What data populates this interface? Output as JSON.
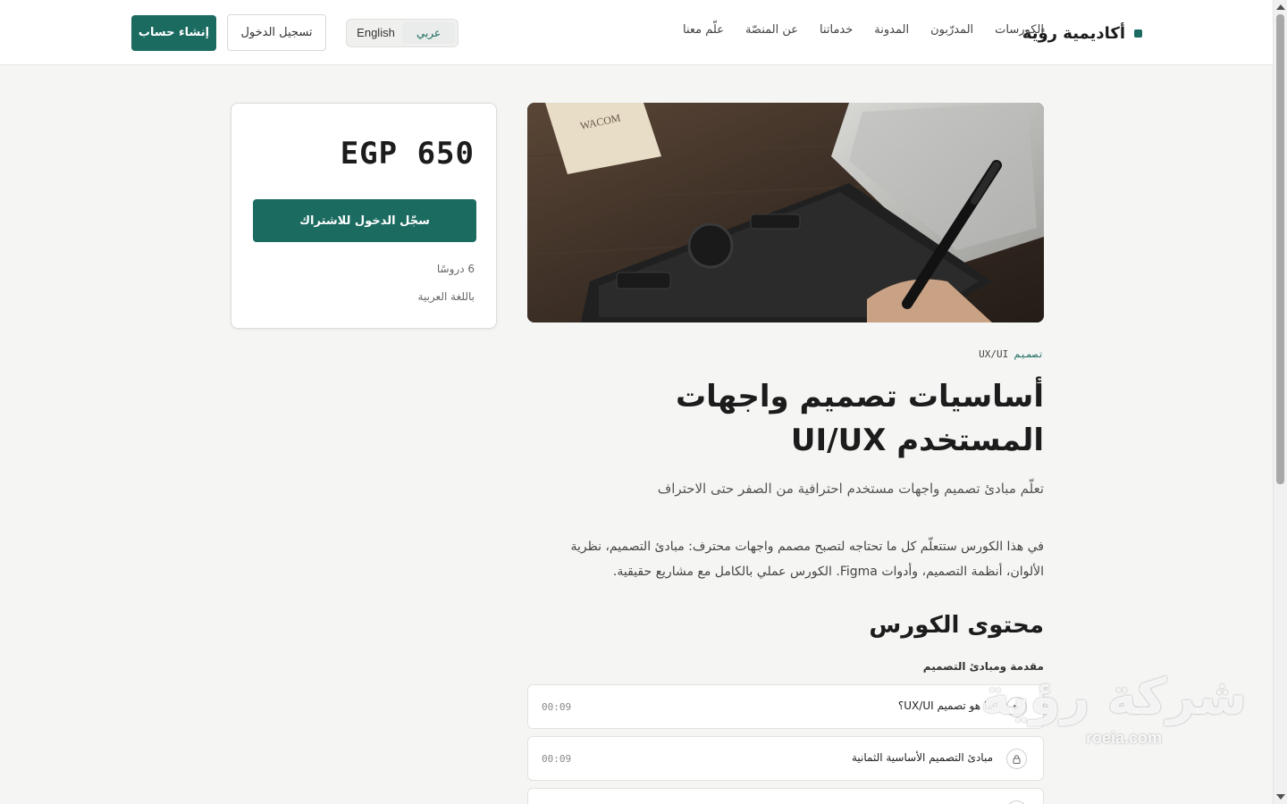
{
  "header": {
    "brand": "أكاديمية رؤية",
    "nav": [
      "الكورسات",
      "المدرّبون",
      "المدونة",
      "خدماتنا",
      "عن المنصّة",
      "علّم معنا"
    ],
    "lang_ar": "عربي",
    "lang_en": "English",
    "login_label": "تسجيل الدخول",
    "signup_label": "إنشاء حساب"
  },
  "price_card": {
    "price": "EGP 650",
    "subscribe_label": "سجّل الدخول للاشتراك",
    "lessons_count": "6 دروسًا",
    "language": "باللغة العربية"
  },
  "course": {
    "tag_prefix": "تصميم",
    "tag_suffix": "UX/UI",
    "title": "أساسيات تصميم واجهات المستخدم UI/UX",
    "subtitle": "تعلّم مبادئ تصميم واجهات مستخدم احترافية من الصفر حتى الاحتراف",
    "description": "في هذا الكورس ستتعلّم كل ما تحتاجه لتصبح مصمم واجهات محترف: مبادئ التصميم، نظرية الألوان، أنظمة التصميم، وأدوات Figma. الكورس عملي بالكامل مع مشاريع حقيقية."
  },
  "content": {
    "section_title": "محتوى الكورس",
    "module_title": "مقدمة ومبادئ التصميم",
    "lessons": [
      {
        "title": "ما هو تصميم UX/UI؟",
        "time": "00:09",
        "icon": "play-icon"
      },
      {
        "title": "مبادئ التصميم الأساسية الثمانية",
        "time": "00:09",
        "icon": "lock-icon"
      },
      {
        "title": "",
        "time": "",
        "icon": "lock-icon"
      }
    ]
  },
  "watermark": {
    "arabic": "شركة رؤية",
    "latin": "roeia.com"
  },
  "colors": {
    "accent": "#1b6b60",
    "background": "#f5f5f4"
  }
}
